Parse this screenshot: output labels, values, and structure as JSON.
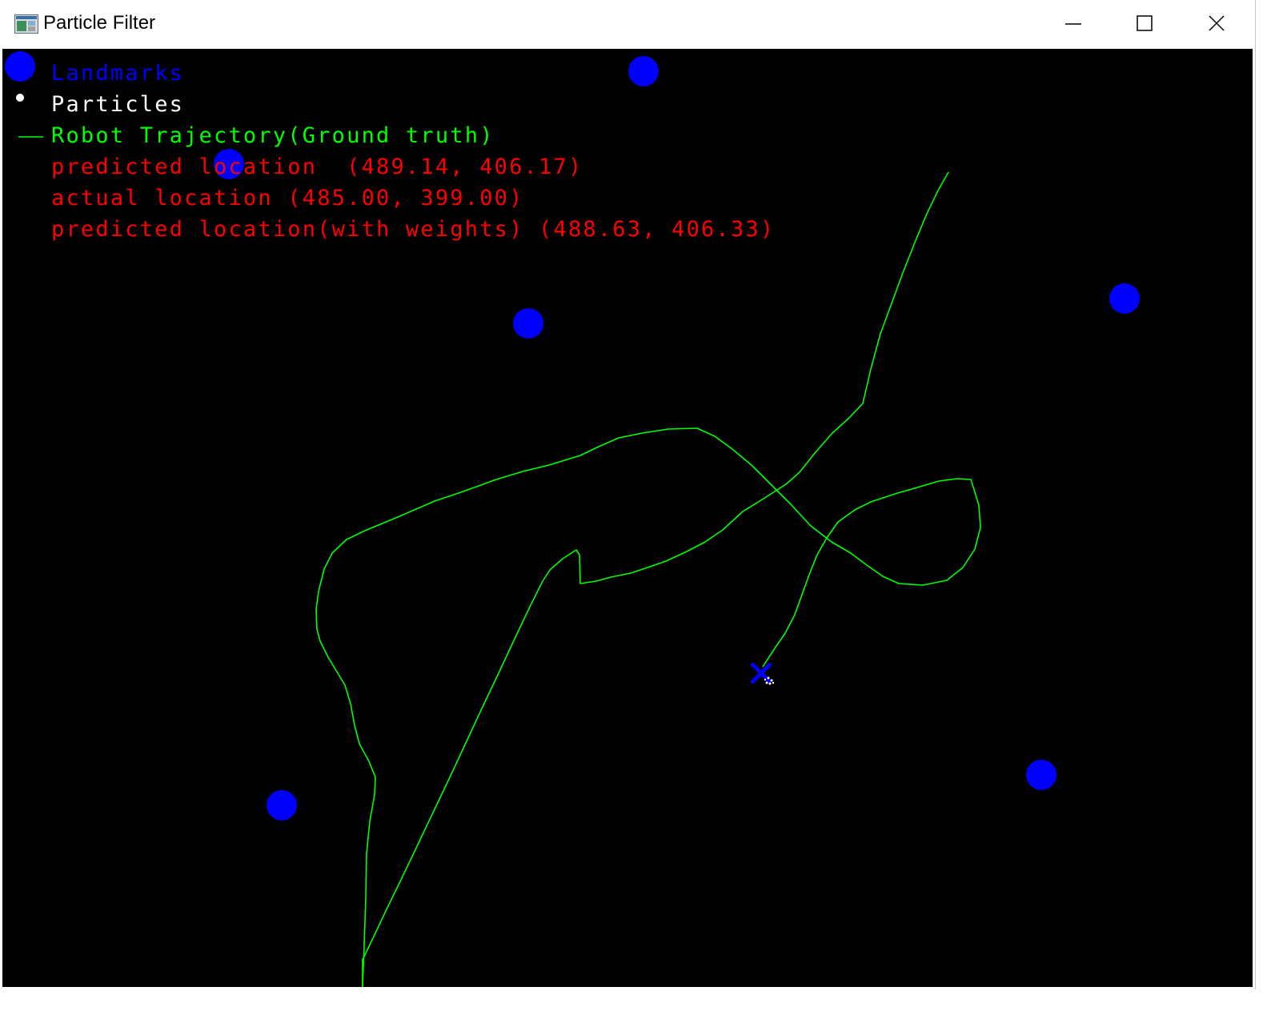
{
  "window": {
    "title": "Particle Filter",
    "icon": "opencv-window-icon",
    "controls": [
      "minimize-icon",
      "maximize-icon",
      "close-icon"
    ]
  },
  "canvas": {
    "background": "#000000",
    "colors": {
      "landmark": "#0000ff",
      "particle": "#ffffff",
      "trajectory": "#00ff00",
      "estimate_text": "#ff0000",
      "robot_marker": "#0000ff"
    },
    "legend": {
      "landmarks": "Landmarks",
      "particles": "Particles",
      "trajectory": "Robot Trajectory(Ground truth)",
      "predicted": "predicted location  (489.14, 406.17)",
      "actual": "actual location (485.00, 399.00)",
      "predicted_weighted": "predicted location(with weights) (488.63, 406.33)"
    }
  }
}
